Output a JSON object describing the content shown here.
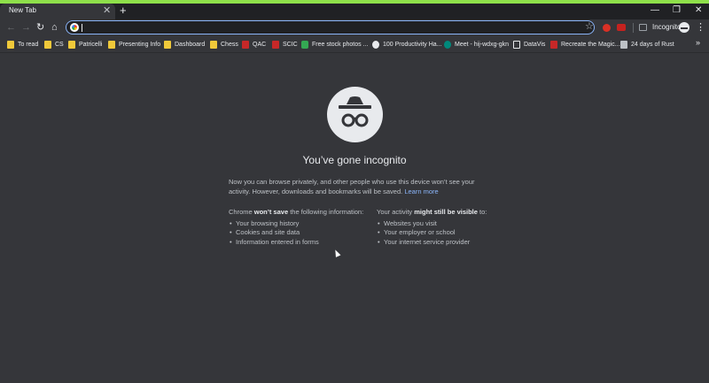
{
  "tab": {
    "title": "New Tab",
    "close": "✕",
    "new_tab": "+"
  },
  "window": {
    "minimize": "—",
    "restore": "❐",
    "close": "✕"
  },
  "toolbar": {
    "back": "←",
    "forward": "→",
    "reload": "↻",
    "home": "⌂",
    "star": "☆",
    "profile_label": "Incognito",
    "menu": "⋮"
  },
  "omnibox": {
    "value": "",
    "placeholder": ""
  },
  "bookmarks": [
    {
      "label": "To read",
      "icon": "folder-icon"
    },
    {
      "label": "CS",
      "icon": "folder-icon"
    },
    {
      "label": "Patricelli",
      "icon": "folder-icon"
    },
    {
      "label": "Presenting Info",
      "icon": "folder-icon"
    },
    {
      "label": "Dashboard",
      "icon": "folder-icon"
    },
    {
      "label": "Chess",
      "icon": "folder-icon"
    },
    {
      "label": "QAC",
      "icon": "wesleyan-icon"
    },
    {
      "label": "SCIC",
      "icon": "wesleyan-icon"
    },
    {
      "label": "Free stock photos ...",
      "icon": "pexels-icon"
    },
    {
      "label": "100 Productivity Ha...",
      "icon": "video-icon"
    },
    {
      "label": "Meet - hij-wdxg-gkn",
      "icon": "meet-icon"
    },
    {
      "label": "DataVis",
      "icon": "page-icon"
    },
    {
      "label": "Recreate the Magic...",
      "icon": "red-square-icon"
    },
    {
      "label": "24 days of Rust",
      "icon": "book-icon"
    }
  ],
  "bookmarks_more": "»",
  "incognito": {
    "headline": "You’ve gone incognito",
    "intro": "Now you can browse privately, and other people who use this device won’t see your activity. However, downloads and bookmarks will be saved.",
    "learn_more": "Learn more",
    "left_prefix": "Chrome ",
    "left_bold": "won’t save",
    "left_suffix": " the following information:",
    "left_items": [
      "Your browsing history",
      "Cookies and site data",
      "Information entered in forms"
    ],
    "right_prefix": "Your activity ",
    "right_bold": "might still be visible",
    "right_suffix": " to:",
    "right_items": [
      "Websites you visit",
      "Your employer or school",
      "Your internet service provider"
    ]
  },
  "colors": {
    "accent_link": "#8ab4f8",
    "background": "#35363a",
    "tabstrip": "#202124",
    "top_accent": "#8ee04a"
  }
}
